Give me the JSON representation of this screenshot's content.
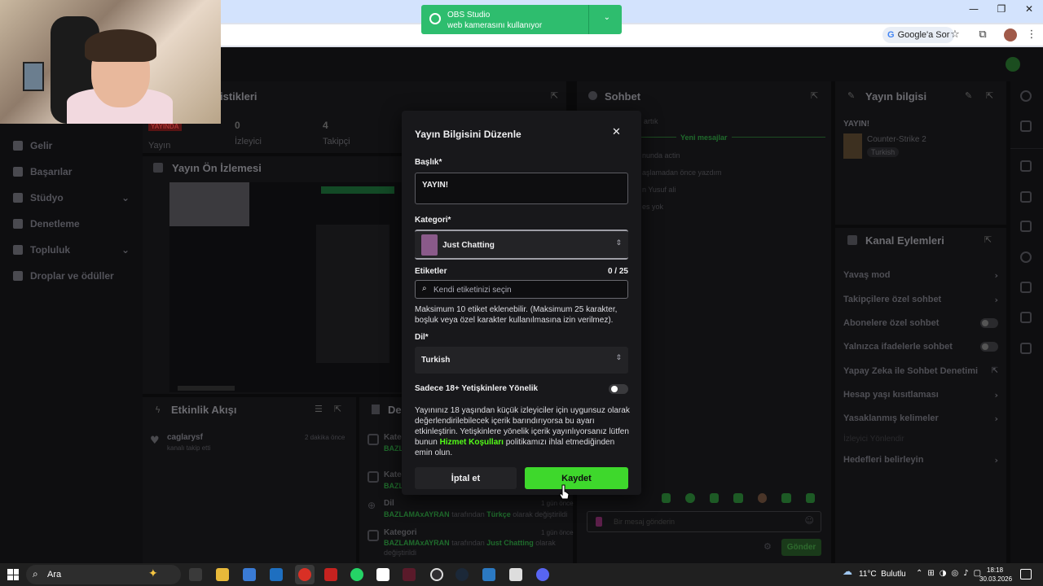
{
  "browser": {
    "google_btn": "Google'a Sor",
    "win_min": "—",
    "win_max": "❐",
    "win_close": "✕"
  },
  "notification": {
    "app": "OBS Studio",
    "message": "web kamerasını kullanıyor"
  },
  "sidebar": {
    "items": [
      {
        "label": "Gelir"
      },
      {
        "label": "Başarılar"
      },
      {
        "label": "Stüdyo"
      },
      {
        "label": "Denetleme"
      },
      {
        "label": "Topluluk"
      },
      {
        "label": "Droplar ve ödüller"
      }
    ]
  },
  "stats": {
    "title_partial": "istikleri",
    "live_badge": "YAYINDA",
    "live_label": "Yayın",
    "viewers_value": "0",
    "viewers_label": "İzleyici",
    "followers_value": "4",
    "followers_label": "Takipçi"
  },
  "preview": {
    "title": "Yayın Ön İzlemesi"
  },
  "activity": {
    "title": "Etkinlik Akışı",
    "user": "caglarysf",
    "event": "kanalı takip etti",
    "time": "2 dakika önce"
  },
  "right_feed": {
    "title_partial": "De",
    "items": [
      {
        "title": "Kate",
        "sub": "BAZL"
      },
      {
        "title": "Kate",
        "sub": "BAZL"
      },
      {
        "title": "Dil",
        "time": "1 gün önce",
        "user": "BAZLAMAxAYRAN",
        "mid": "tarafından",
        "value": "Türkçe",
        "tail": "olarak değiştirildi"
      },
      {
        "title": "Kategori",
        "time": "1 gün önce",
        "user": "BAZLAMAxAYRAN",
        "mid": "tarafından",
        "value": "Just Chatting",
        "tail": "olarak",
        "tail2": "değiştirildi"
      }
    ]
  },
  "chat": {
    "title": "Sohbet",
    "new_messages": "Yeni mesajlar",
    "lines": [
      "artık",
      "nunda actin",
      "aşlamadan önce yazdım",
      "n Yusuf ali",
      "es yok"
    ],
    "input_placeholder": "Bir mesaj gönderin",
    "send": "Gönder"
  },
  "stream_info": {
    "title": "Yayın bilgisi",
    "stream_title": "YAYIN!",
    "game": "Counter-Strike 2",
    "language_tag": "Turkish"
  },
  "channel_actions": {
    "title": "Kanal Eylemleri",
    "items": [
      {
        "label": "Yavaş mod",
        "control": "chevron"
      },
      {
        "label": "Takipçilere özel sohbet",
        "control": "chevron"
      },
      {
        "label": "Abonelere özel sohbet",
        "control": "toggle"
      },
      {
        "label": "Yalnızca ifadelerle sohbet",
        "control": "toggle"
      },
      {
        "label": "Yapay Zeka ile Sohbet Denetimi",
        "control": "external"
      },
      {
        "label": "Hesap yaşı kısıtlaması",
        "control": "chevron"
      },
      {
        "label": "Yasaklanmış kelimeler",
        "control": "chevron"
      },
      {
        "label": "İzleyici Yönlendir",
        "control": "none"
      },
      {
        "label": "Hedefleri belirleyin",
        "control": "chevron"
      }
    ]
  },
  "modal": {
    "title": "Yayın Bilgisini Düzenle",
    "title_label": "Başlık*",
    "title_value": "YAYIN!",
    "category_label": "Kategori*",
    "category_value": "Just Chatting",
    "tags_label": "Etiketler",
    "tags_count": "0 / 25",
    "tags_placeholder": "Kendi etiketinizi seçin",
    "tags_help": "Maksimum 10 etiket eklenebilir. (Maksimum 25 karakter, boşluk veya özel karakter kullanılmasına izin verilmez).",
    "language_label": "Dil*",
    "language_value": "Turkish",
    "adult_label": "Sadece 18+ Yetişkinlere Yönelik",
    "adult_enabled": false,
    "adult_desc_1": "Yayınınız 18 yaşından küçük izleyiciler için uygunsuz olarak değerlendirilebilecek içerik barındırıyorsa bu ayarı etkinleştirin. Yetişkinlere yönelik içerik yayınlıyorsanız lütfen bunun ",
    "adult_desc_link": "Hizmet Koşulları",
    "adult_desc_2": " politikamızı ihlal etmediğinden emin olun.",
    "cancel": "İptal et",
    "save": "Kaydet"
  },
  "taskbar": {
    "search": "Ara",
    "weather": "11°C  Bulutlu",
    "time": "18:18",
    "date": "30.03.2026"
  },
  "colors": {
    "accent": "#3ed82c",
    "link": "#53fc18",
    "obs_green": "#2ebd6e",
    "modal_bg": "#18181b"
  }
}
